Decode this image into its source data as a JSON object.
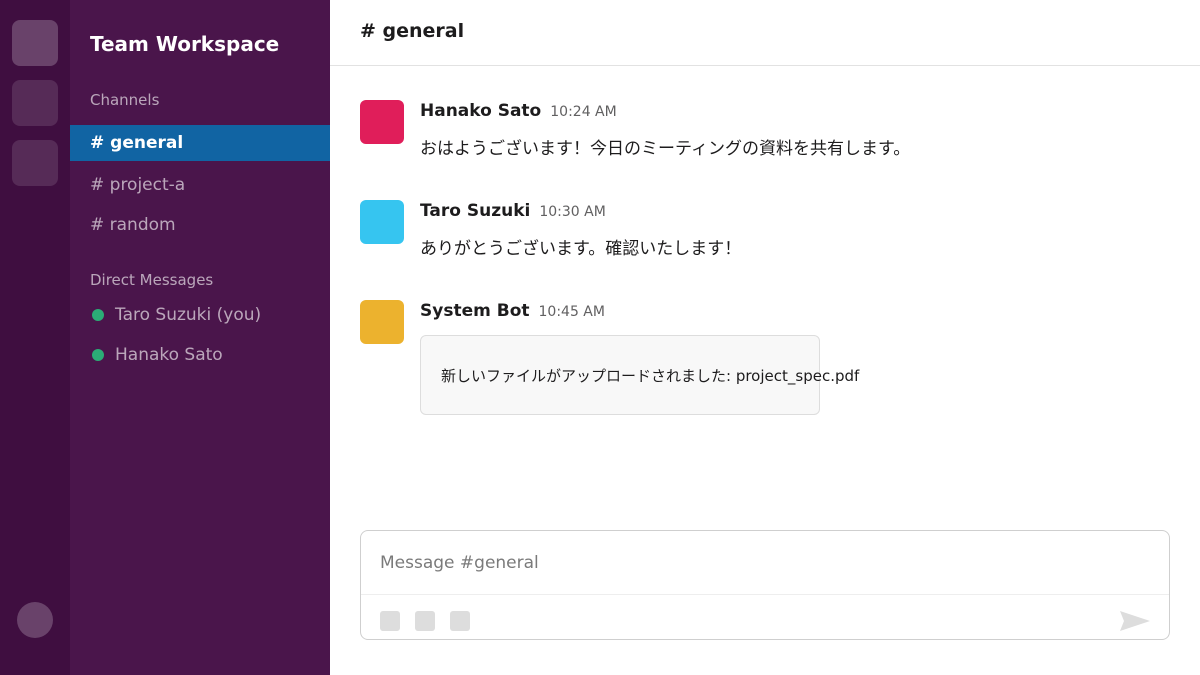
{
  "workspace": {
    "name": "Team Workspace"
  },
  "sidebar": {
    "channels_label": "Channels",
    "channels": [
      {
        "label": "# general",
        "active": true
      },
      {
        "label": "# project-a",
        "active": false
      },
      {
        "label": "# random",
        "active": false
      }
    ],
    "dm_label": "Direct Messages",
    "direct_messages": [
      {
        "label": "Taro Suzuki (you)",
        "status": "online"
      },
      {
        "label": "Hanako Sato",
        "status": "online"
      }
    ]
  },
  "header": {
    "channel": "# general"
  },
  "messages": [
    {
      "author": "Hanako Sato",
      "time": "10:24 AM",
      "text": "おはようございます！今日のミーティングの資料を共有します。",
      "avatar_color": "#e01e5a"
    },
    {
      "author": "Taro Suzuki",
      "time": "10:30 AM",
      "text": "ありがとうございます。確認いたします！",
      "avatar_color": "#36c5f0"
    },
    {
      "author": "System Bot",
      "time": "10:45 AM",
      "attachment_text": "新しいファイルがアップロードされました: project_spec.pdf",
      "avatar_color": "#ecb22e"
    }
  ],
  "composer": {
    "placeholder": "Message #general",
    "value": "",
    "tools": [
      "format-icon",
      "attach-icon",
      "emoji-icon"
    ],
    "send_icon": "send-icon"
  },
  "colors": {
    "rail": "#3f0e40",
    "sidebar": "#4a154b",
    "active_channel": "#1164a3",
    "presence": "#2bac76"
  }
}
